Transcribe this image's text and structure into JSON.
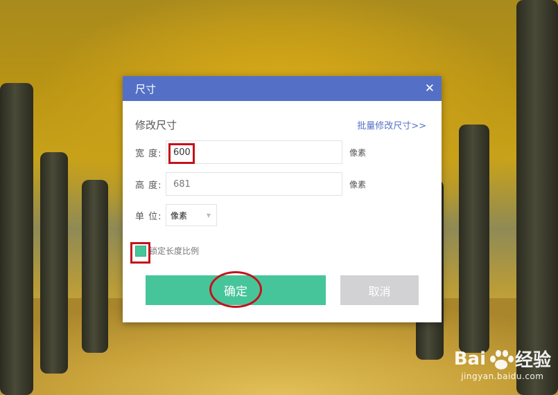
{
  "dialog": {
    "title": "尺寸",
    "close_symbol": "✕",
    "section_title": "修改尺寸",
    "batch_link": "批量修改尺寸>>",
    "width": {
      "label": "宽 度:",
      "value": "600",
      "unit": "像素"
    },
    "height": {
      "label": "高 度:",
      "value": "681",
      "unit": "像素"
    },
    "unit_field": {
      "label": "单 位:",
      "selected": "像素"
    },
    "lock_ratio_label": "锁定长度比例",
    "lock_ratio_checked": true,
    "ok_label": "确定",
    "cancel_label": "取消"
  },
  "watermark": {
    "brand_left": "Bai",
    "brand_right": "经验",
    "url": "jingyan.baidu.com"
  },
  "colors": {
    "titlebar": "#5470c6",
    "primary": "#47c59a",
    "cancel": "#d2d2d5",
    "highlight": "#c3121b"
  }
}
